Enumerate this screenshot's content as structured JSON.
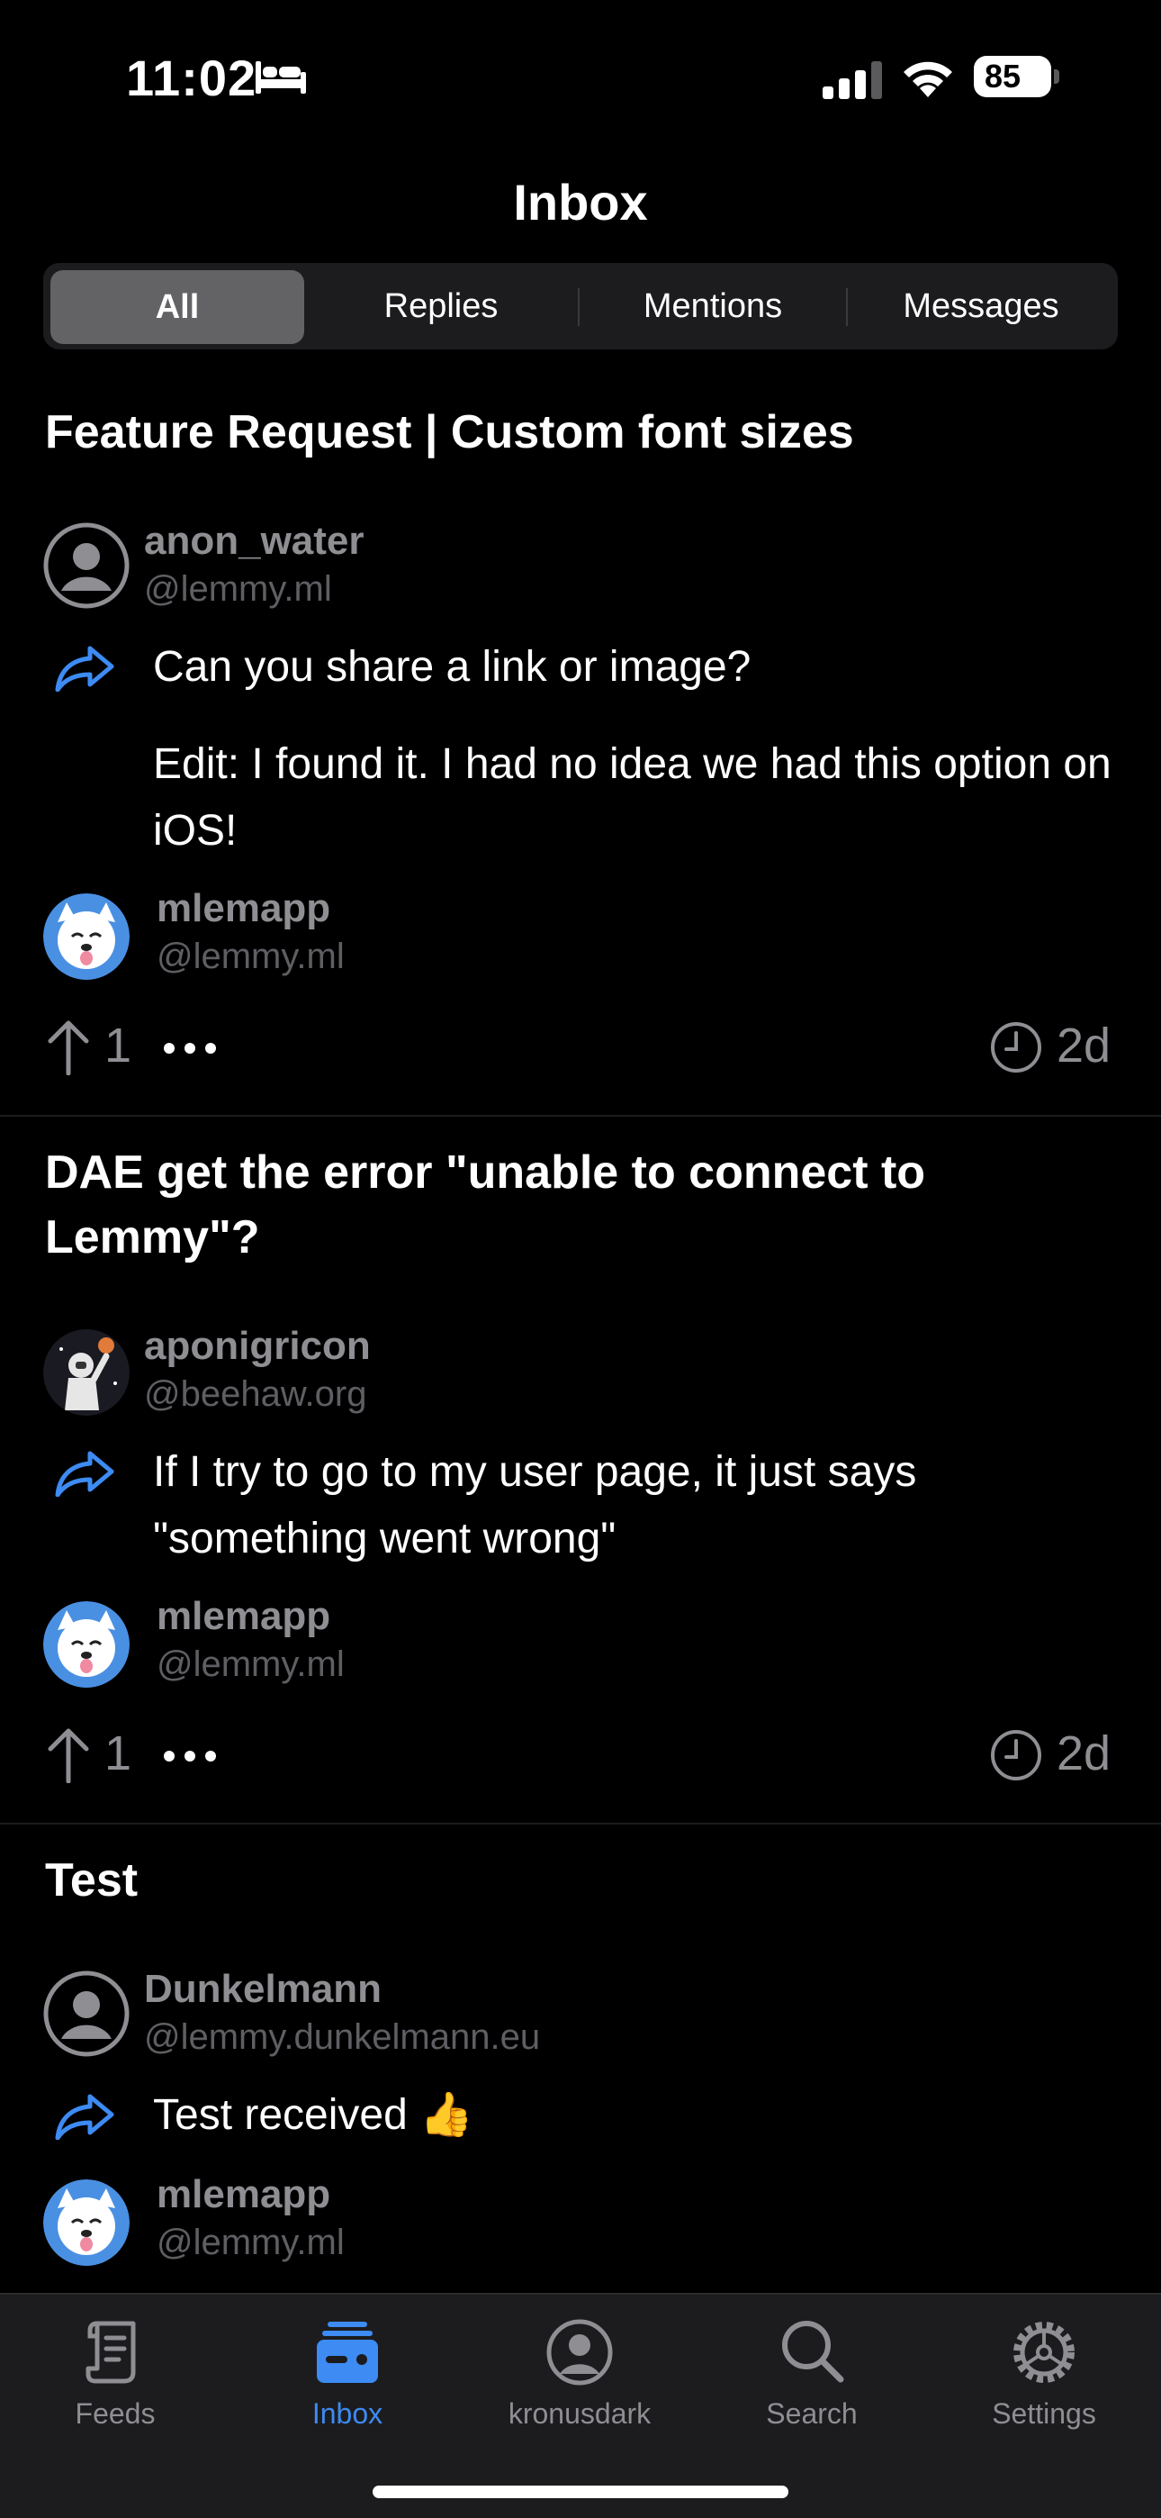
{
  "status_bar": {
    "time": "11:02",
    "battery": "85"
  },
  "nav": {
    "title": "Inbox"
  },
  "segments": [
    "All",
    "Replies",
    "Mentions",
    "Messages"
  ],
  "items": [
    {
      "title": "Feature Request | Custom font sizes",
      "author": {
        "name": "anon_water",
        "instance": "@lemmy.ml"
      },
      "body": [
        "Can you share a link or image?",
        "Edit: I found it. I had no idea we had this option on iOS!"
      ],
      "recipient": {
        "name": "mlemapp",
        "instance": "@lemmy.ml"
      },
      "votes": "1",
      "age": "2d"
    },
    {
      "title": "DAE get the error \"unable to connect to Lemmy\"?",
      "author": {
        "name": "aponigricon",
        "instance": "@beehaw.org"
      },
      "body": [
        "If I try to go to my user page, it just says \"something went wrong\""
      ],
      "recipient": {
        "name": "mlemapp",
        "instance": "@lemmy.ml"
      },
      "votes": "1",
      "age": "2d"
    },
    {
      "title": "Test",
      "author": {
        "name": "Dunkelmann",
        "instance": "@lemmy.dunkelmann.eu"
      },
      "body": [
        "Test received 👍"
      ],
      "recipient": {
        "name": "mlemapp",
        "instance": "@lemmy.ml"
      }
    }
  ],
  "tabbar": [
    {
      "label": "Feeds",
      "icon": "scroll-icon"
    },
    {
      "label": "Inbox",
      "icon": "inbox-tray-icon"
    },
    {
      "label": "kronusdark",
      "icon": "person-circle-icon"
    },
    {
      "label": "Search",
      "icon": "magnifier-icon"
    },
    {
      "label": "Settings",
      "icon": "gear-icon"
    }
  ],
  "colors": {
    "accent": "#3d8bf3",
    "background": "#000000",
    "secondary_text": "#8e8e93"
  }
}
